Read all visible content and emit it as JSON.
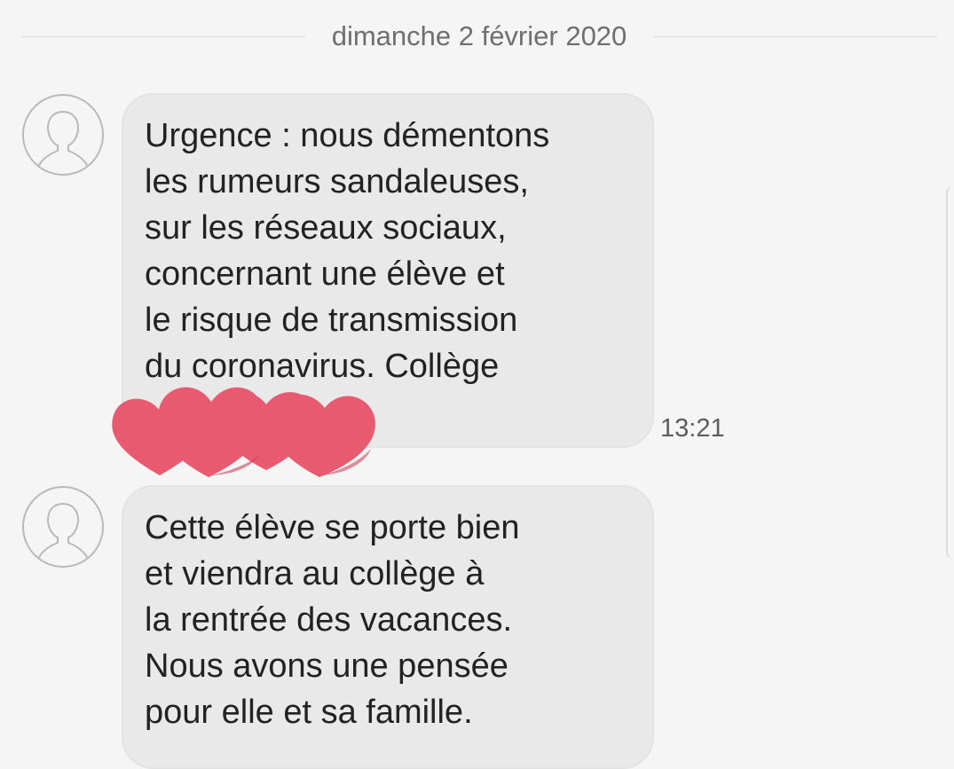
{
  "date_separator": "dimanche 2 février 2020",
  "messages": [
    {
      "text": "Urgence : nous démentons\nles rumeurs sandaleuses,\nsur les réseaux sociaux,\nconcernant une élève et\nle risque de transmission\ndu coronavirus. Collège",
      "time": "13:21"
    },
    {
      "text": "Cette élève se porte bien\net viendra au collège à\nla rentrée des vacances.\nNous avons une pensée\npour elle et sa famille."
    }
  ],
  "colors": {
    "bubble_bg": "#e9e9e9",
    "redaction_hearts": "#e85a70"
  },
  "icons": {
    "avatar": "person-silhouette-icon",
    "redaction": "hearts-sticker"
  }
}
